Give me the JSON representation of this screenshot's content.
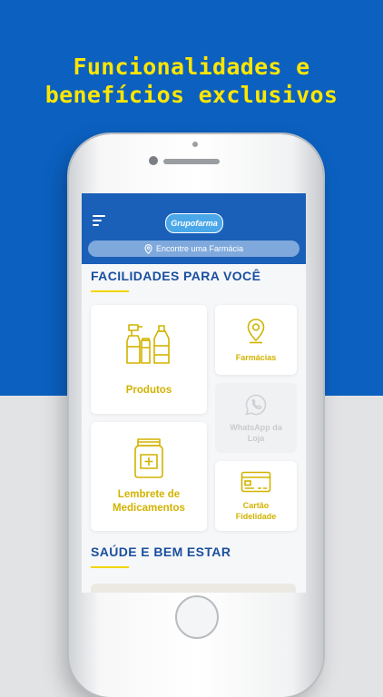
{
  "headline": {
    "line1": "Funcionalidades e",
    "line2": "benefícios exclusivos"
  },
  "colors": {
    "brand_blue": "#0b60c0",
    "accent_yellow": "#ffe600",
    "card_yellow": "#d2b300",
    "title_blue": "#1a4f9e"
  },
  "app": {
    "logo_text": "Grupofarma",
    "menu_icon": "hamburger-menu-icon",
    "find_pharmacy": {
      "icon": "location-pin-icon",
      "label": "Encontre uma Farmácia"
    }
  },
  "sections": {
    "facilities_title": "FACILIDADES PARA VOCÊ",
    "health_title": "SAÚDE E BEM ESTAR"
  },
  "cards": {
    "produtos": {
      "label": "Produtos",
      "icon": "cleaning-bottles-icon"
    },
    "farmacias": {
      "label": "Farmácias",
      "icon": "map-pin-icon"
    },
    "whatsapp": {
      "label": "WhatsApp da Loja",
      "icon": "whatsapp-icon",
      "enabled": false
    },
    "lembrete": {
      "label": "Lembrete de Medicamentos",
      "icon": "medicine-jar-icon"
    },
    "cartao": {
      "label": "Cartão Fidelidade",
      "icon": "credit-card-icon"
    }
  }
}
